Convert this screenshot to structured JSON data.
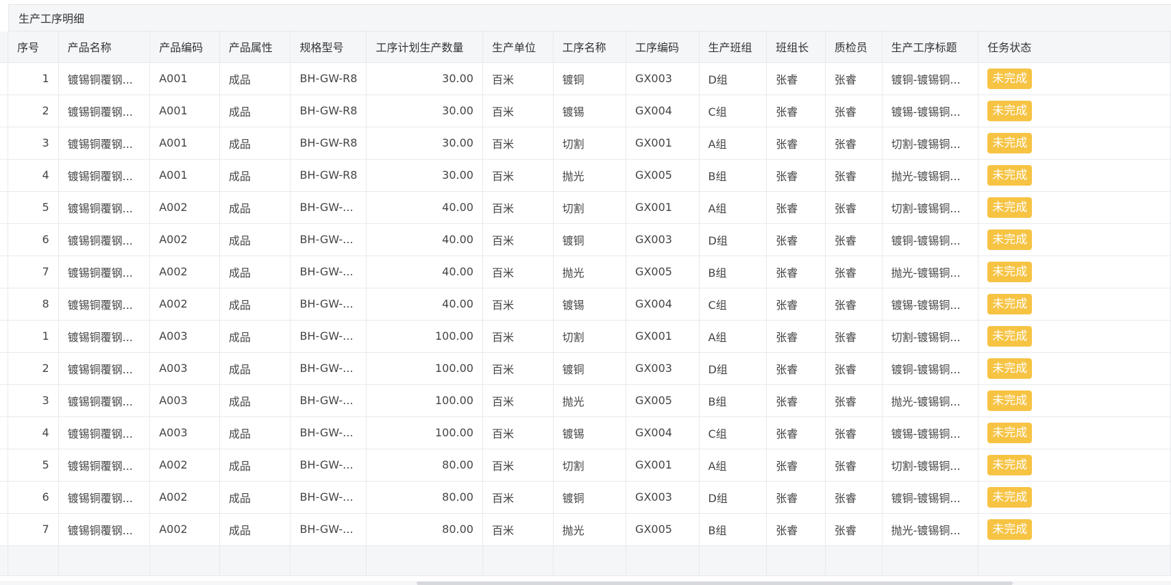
{
  "panel": {
    "title": "生产工序明细"
  },
  "table": {
    "columns": [
      "序号",
      "产品名称",
      "产品编码",
      "产品属性",
      "规格型号",
      "工序计划生产数量",
      "生产单位",
      "工序名称",
      "工序编码",
      "生产班组",
      "班组长",
      "质检员",
      "生产工序标题",
      "任务状态"
    ],
    "rows": [
      [
        "1",
        "镀锡铜覆钢...",
        "A001",
        "成品",
        "BH-GW-R8",
        "30.00",
        "百米",
        "镀铜",
        "GX003",
        "D组",
        "张睿",
        "张睿",
        "镀铜-镀锡铜...",
        "未完成"
      ],
      [
        "2",
        "镀锡铜覆钢...",
        "A001",
        "成品",
        "BH-GW-R8",
        "30.00",
        "百米",
        "镀锡",
        "GX004",
        "C组",
        "张睿",
        "张睿",
        "镀锡-镀锡铜...",
        "未完成"
      ],
      [
        "3",
        "镀锡铜覆钢...",
        "A001",
        "成品",
        "BH-GW-R8",
        "30.00",
        "百米",
        "切割",
        "GX001",
        "A组",
        "张睿",
        "张睿",
        "切割-镀锡铜...",
        "未完成"
      ],
      [
        "4",
        "镀锡铜覆钢...",
        "A001",
        "成品",
        "BH-GW-R8",
        "30.00",
        "百米",
        "抛光",
        "GX005",
        "B组",
        "张睿",
        "张睿",
        "抛光-镀锡铜...",
        "未完成"
      ],
      [
        "5",
        "镀锡铜覆钢...",
        "A002",
        "成品",
        "BH-GW-...",
        "40.00",
        "百米",
        "切割",
        "GX001",
        "A组",
        "张睿",
        "张睿",
        "切割-镀锡铜...",
        "未完成"
      ],
      [
        "6",
        "镀锡铜覆钢...",
        "A002",
        "成品",
        "BH-GW-...",
        "40.00",
        "百米",
        "镀铜",
        "GX003",
        "D组",
        "张睿",
        "张睿",
        "镀铜-镀锡铜...",
        "未完成"
      ],
      [
        "7",
        "镀锡铜覆钢...",
        "A002",
        "成品",
        "BH-GW-...",
        "40.00",
        "百米",
        "抛光",
        "GX005",
        "B组",
        "张睿",
        "张睿",
        "抛光-镀锡铜...",
        "未完成"
      ],
      [
        "8",
        "镀锡铜覆钢...",
        "A002",
        "成品",
        "BH-GW-...",
        "40.00",
        "百米",
        "镀锡",
        "GX004",
        "C组",
        "张睿",
        "张睿",
        "镀锡-镀锡铜...",
        "未完成"
      ],
      [
        "1",
        "镀锡铜覆钢...",
        "A003",
        "成品",
        "BH-GW-...",
        "100.00",
        "百米",
        "切割",
        "GX001",
        "A组",
        "张睿",
        "张睿",
        "切割-镀锡铜...",
        "未完成"
      ],
      [
        "2",
        "镀锡铜覆钢...",
        "A003",
        "成品",
        "BH-GW-...",
        "100.00",
        "百米",
        "镀铜",
        "GX003",
        "D组",
        "张睿",
        "张睿",
        "镀铜-镀锡铜...",
        "未完成"
      ],
      [
        "3",
        "镀锡铜覆钢...",
        "A003",
        "成品",
        "BH-GW-...",
        "100.00",
        "百米",
        "抛光",
        "GX005",
        "B组",
        "张睿",
        "张睿",
        "抛光-镀锡铜...",
        "未完成"
      ],
      [
        "4",
        "镀锡铜覆钢...",
        "A003",
        "成品",
        "BH-GW-...",
        "100.00",
        "百米",
        "镀锡",
        "GX004",
        "C组",
        "张睿",
        "张睿",
        "镀锡-镀锡铜...",
        "未完成"
      ],
      [
        "5",
        "镀锡铜覆钢...",
        "A002",
        "成品",
        "BH-GW-...",
        "80.00",
        "百米",
        "切割",
        "GX001",
        "A组",
        "张睿",
        "张睿",
        "切割-镀锡铜...",
        "未完成"
      ],
      [
        "6",
        "镀锡铜覆钢...",
        "A002",
        "成品",
        "BH-GW-...",
        "80.00",
        "百米",
        "镀铜",
        "GX003",
        "D组",
        "张睿",
        "张睿",
        "镀铜-镀锡铜...",
        "未完成"
      ],
      [
        "7",
        "镀锡铜覆钢...",
        "A002",
        "成品",
        "BH-GW-...",
        "80.00",
        "百米",
        "抛光",
        "GX005",
        "B组",
        "张睿",
        "张睿",
        "抛光-镀锡铜...",
        "未完成"
      ]
    ]
  },
  "colors": {
    "status_badge_bg": "#f6c343",
    "header_bg": "#f5f6f8",
    "grid_line": "#e8e9ec"
  }
}
